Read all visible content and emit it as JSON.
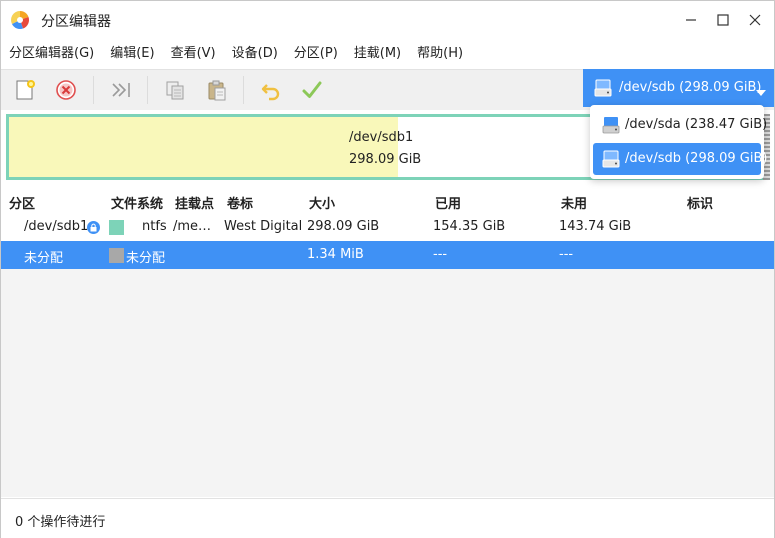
{
  "window": {
    "title": "分区编辑器"
  },
  "menu": [
    "分区编辑器(G)",
    "编辑(E)",
    "查看(V)",
    "设备(D)",
    "分区(P)",
    "挂载(M)",
    "帮助(H)"
  ],
  "toolbar": {
    "icons": [
      "new-partition-icon",
      "delete-icon",
      "resize-move-icon",
      "copy-icon",
      "paste-icon",
      "undo-icon",
      "apply-icon"
    ]
  },
  "device_selector": {
    "selected": "/dev/sdb (298.09 GiB)"
  },
  "device_dropdown": {
    "options": [
      "/dev/sda (238.47 GiB)",
      "/dev/sdb (298.09 GiB)"
    ],
    "selected_index": 1
  },
  "graphic": {
    "name": "/dev/sdb1",
    "size": "298.09 GiB",
    "used_fraction": 0.518
  },
  "table": {
    "headers": [
      "分区",
      "文件系统",
      "挂载点",
      "卷标",
      "大小",
      "已用",
      "未用",
      "标识"
    ],
    "rows": [
      {
        "partition": "/dev/sdb1",
        "filesystem": "ntfs",
        "mountpoint": "/me…",
        "label": "West Digital",
        "size": "298.09 GiB",
        "used": "154.35 GiB",
        "unused": "143.74 GiB",
        "flags": ""
      },
      {
        "partition": "未分配",
        "filesystem": "未分配",
        "mountpoint": "",
        "label": "",
        "size": "1.34 MiB",
        "used": "---",
        "unused": "---",
        "flags": ""
      }
    ]
  },
  "colors": {
    "accent": "#3f91f5",
    "ntfs": "#7dd3b8",
    "unallocated": "#a8a8a8",
    "used_space": "#f9f8ba"
  },
  "status": {
    "text": "0 个操作待进行"
  }
}
